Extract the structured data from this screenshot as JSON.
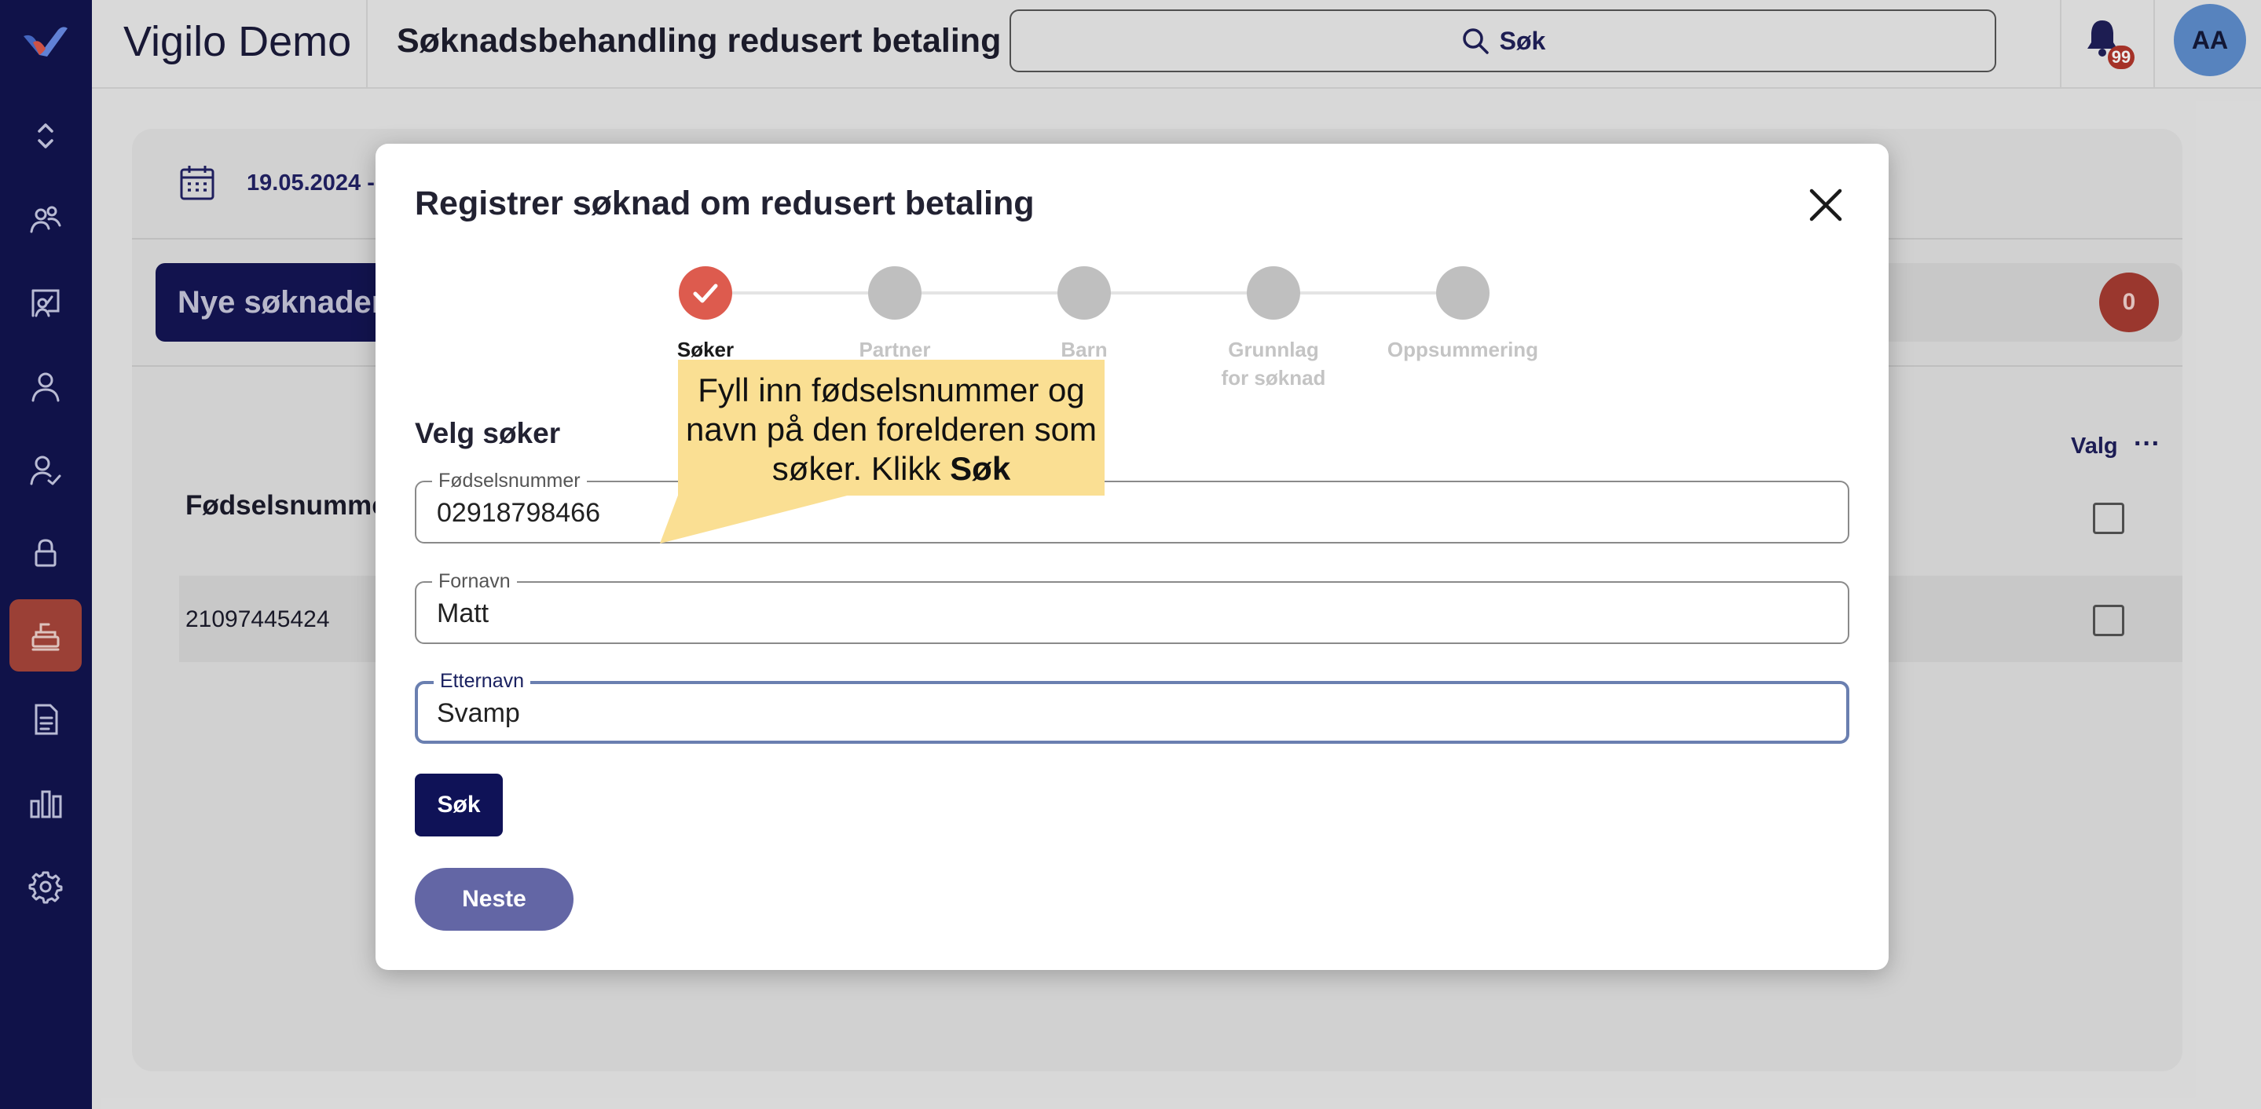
{
  "header": {
    "app_title": "Vigilo Demo",
    "page_title": "Søknadsbehandling redusert betaling",
    "search_label": "Søk",
    "notifications_count": "99",
    "avatar_initials": "AA"
  },
  "sidebar": {
    "items": [
      {
        "icon": "collapse-chevrons-icon"
      },
      {
        "icon": "group-icon"
      },
      {
        "icon": "presentation-icon"
      },
      {
        "icon": "user-icon"
      },
      {
        "icon": "user-check-icon"
      },
      {
        "icon": "lock-icon"
      },
      {
        "icon": "cash-register-icon",
        "active": true
      },
      {
        "icon": "document-icon"
      },
      {
        "icon": "bar-chart-icon"
      },
      {
        "icon": "gear-icon"
      }
    ]
  },
  "background": {
    "date_range": "19.05.2024 -",
    "tab_label": "Nye søknader",
    "tab_count": "0",
    "column_header": "Fødselsnummer",
    "options_label": "Valg",
    "more_label": "···",
    "rows": [
      {
        "fodselsnummer": "21097445424"
      }
    ]
  },
  "modal": {
    "title": "Registrer søknad om redusert betaling",
    "steps": [
      {
        "label": "Søker",
        "state": "done"
      },
      {
        "label": "Partner",
        "state": "pending"
      },
      {
        "label": "Barn",
        "state": "pending"
      },
      {
        "label": "Grunnlag for søknad",
        "state": "pending"
      },
      {
        "label": "Oppsummering",
        "state": "pending"
      }
    ],
    "section_title": "Velg søker",
    "fields": {
      "fodselsnummer": {
        "label": "Fødselsnummer",
        "value": "02918798466"
      },
      "fornavn": {
        "label": "Fornavn",
        "value": "Matt"
      },
      "etternavn": {
        "label": "Etternavn",
        "value": "Svamp"
      }
    },
    "search_button": "Søk",
    "next_button": "Neste"
  },
  "tooltip": {
    "text": "Fyll inn fødselsnummer og navn på den forelderen som søker. Klikk",
    "bold": "Søk"
  },
  "colors": {
    "sidebar_bg": "#121450",
    "primary": "#0f1257",
    "active_item": "#a9463b",
    "step_done": "#dd5b4e",
    "tooltip_bg": "#fadf93",
    "next_button": "#6366a5"
  }
}
